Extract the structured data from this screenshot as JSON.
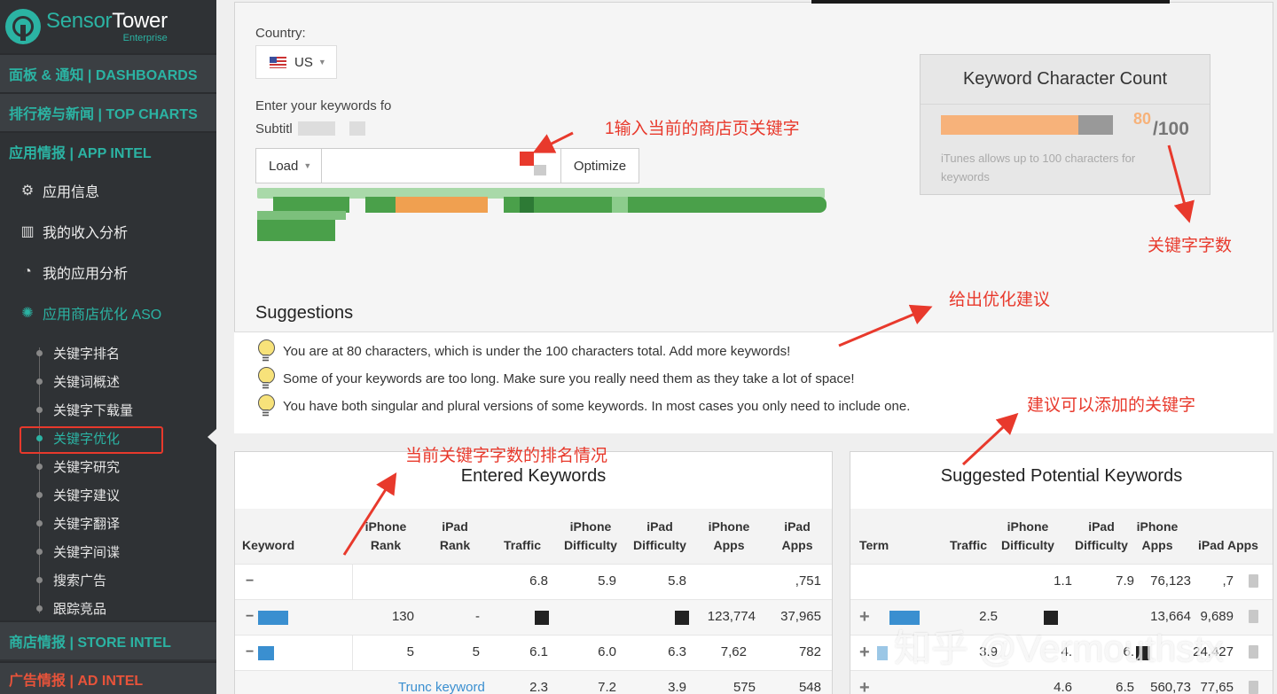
{
  "brand": {
    "name_a": "Sensor",
    "name_b": "Tower",
    "sub": "Enterprise"
  },
  "sidebar": {
    "sections": {
      "dashboards": "面板 & 通知 | DASHBOARDS",
      "top_charts": "排行榜与新闻 | TOP CHARTS",
      "app_intel": "应用情报 | APP INTEL",
      "store_intel": "商店情报 | STORE INTEL",
      "ad_intel": "广告情报 | AD INTEL"
    },
    "items": [
      "应用信息",
      "我的收入分析",
      "我的应用分析",
      "应用商店优化 ASO"
    ],
    "sub_items": [
      "关键字排名",
      "关键词概述",
      "关键字下载量",
      "关键字优化",
      "关键字研究",
      "关键字建议",
      "关键字翻译",
      "关键字间谍",
      "搜索广告",
      "跟踪竞品"
    ]
  },
  "form": {
    "country_label": "Country:",
    "country_value": "US",
    "keywords_label": "Enter your keywords fo",
    "subtitle_label": "Subtitl",
    "load_label": "Load",
    "optimize_label": "Optimize"
  },
  "kcc": {
    "title": "Keyword Character Count",
    "used": "80",
    "total": "/100",
    "used_fraction": 0.8,
    "note": "iTunes allows up to 100 characters for keywords"
  },
  "suggestions": {
    "title": "Suggestions",
    "items": [
      "You are at 80 characters, which is under the 100 characters total. Add more keywords!",
      "Some of your keywords are too long. Make sure you really need them as they take a lot of space!",
      "You have both singular and plural versions of some keywords. In most cases you only need to include one."
    ]
  },
  "entered": {
    "title": "Entered Keywords",
    "headers": [
      "Keyword",
      "iPhone Rank",
      "iPad Rank",
      "Traffic",
      "iPhone Difficulty",
      "iPad Difficulty",
      "iPhone Apps",
      "iPad Apps"
    ],
    "rows": [
      [
        "",
        "",
        "",
        "6.8",
        "5.9",
        "5.8",
        "",
        ",751"
      ],
      [
        "",
        "130",
        "-",
        "",
        "",
        "",
        "123,774",
        "37,965"
      ],
      [
        "",
        "5",
        "5",
        "6.1",
        "6.0",
        "6.3",
        "7,62",
        "782"
      ],
      [
        "",
        "",
        "",
        "2.3",
        "7.2",
        "3.9",
        "575",
        "548"
      ]
    ],
    "partial_link": "Trunc keyword"
  },
  "suggested": {
    "title": "Suggested Potential Keywords",
    "headers": [
      "Term",
      "Traffic",
      "iPhone Difficulty",
      "iPad Difficulty",
      "iPhone Apps",
      "iPad Apps"
    ],
    "rows": [
      [
        "",
        "",
        "1.1",
        "7.9",
        "76,123",
        ",7"
      ],
      [
        "",
        "2.5",
        "",
        "",
        "13,664",
        "9,689"
      ],
      [
        "",
        "3.9",
        "4.",
        "6.",
        "",
        "24,427"
      ],
      [
        "",
        "",
        "4.6",
        "6.5",
        "560,73",
        "77,65"
      ]
    ]
  },
  "annotations": {
    "a1": "1输入当前的商店页关键字",
    "a2": "关键字字数",
    "a3": "给出优化建议",
    "a4": "建议可以添加的关键字",
    "a5": "当前关键字字数的排名情况"
  },
  "watermark": "知乎 @Vermouthstx",
  "colors": {
    "accent": "#2bb3a3",
    "sidebar": "#2f3235",
    "annotation": "#e8392c",
    "bar_fill": "#f7b27a"
  }
}
